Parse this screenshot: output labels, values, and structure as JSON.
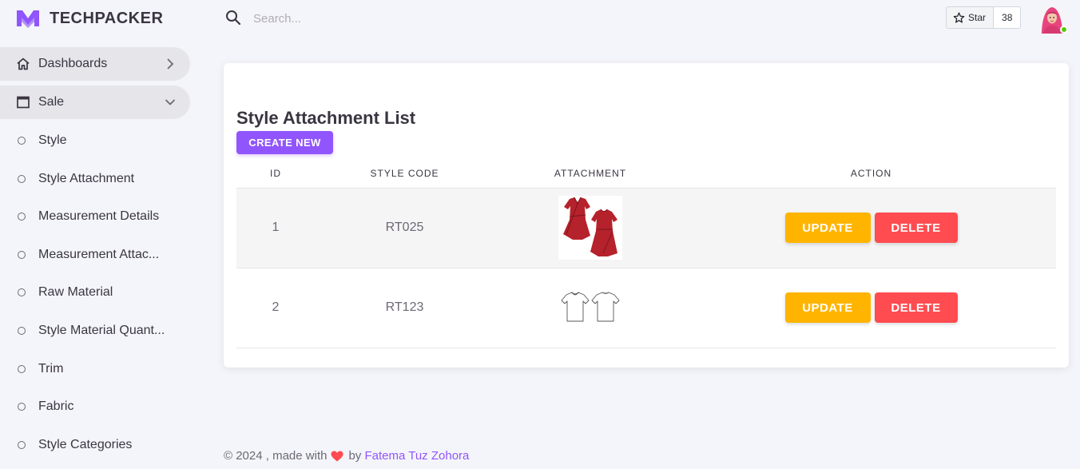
{
  "brand": {
    "name": "TECHPACKER"
  },
  "search": {
    "placeholder": "Search..."
  },
  "github": {
    "star_label": "Star",
    "star_count": "38"
  },
  "sidebar": {
    "dashboards_label": "Dashboards",
    "sale_label": "Sale",
    "items": [
      {
        "label": "Style"
      },
      {
        "label": "Style Attachment"
      },
      {
        "label": "Measurement Details"
      },
      {
        "label": "Measurement Attac..."
      },
      {
        "label": "Raw Material"
      },
      {
        "label": "Style Material Quant..."
      },
      {
        "label": "Trim"
      },
      {
        "label": "Fabric"
      },
      {
        "label": "Style Categories"
      }
    ]
  },
  "main": {
    "title": "Style Attachment List",
    "create_label": "CREATE NEW",
    "table": {
      "headers": [
        "ID",
        "STYLE CODE",
        "ATTACHMENT",
        "ACTION"
      ],
      "rows": [
        {
          "id": "1",
          "style_code": "RT025",
          "attachment": "red-wrap-dress-image",
          "update_label": "UPDATE",
          "delete_label": "DELETE"
        },
        {
          "id": "2",
          "style_code": "RT123",
          "attachment": "white-tshirt-sketch-image",
          "update_label": "UPDATE",
          "delete_label": "DELETE"
        }
      ]
    }
  },
  "footer": {
    "prefix": "© 2024 , made with",
    "by": "by",
    "author": "Fatema Tuz Zohora"
  },
  "colors": {
    "primary": "#9155fd",
    "warning": "#ffb400",
    "error": "#ff4c51",
    "background": "#f4f5fa",
    "online": "#56ca00"
  },
  "icons": {
    "logo": "logo-m-icon",
    "dashboards": "home-icon",
    "sale": "window-icon",
    "search": "search-icon",
    "star": "star-outline-icon",
    "heart": "heart-icon"
  }
}
